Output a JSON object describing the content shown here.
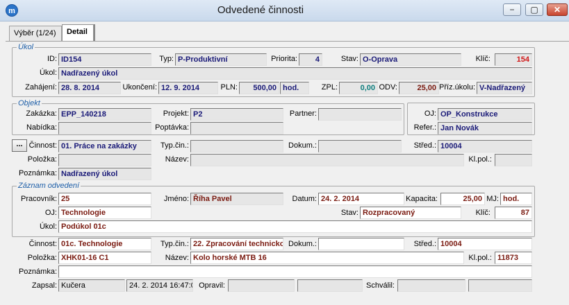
{
  "window": {
    "title": "Odvedené činnosti",
    "icon": "m",
    "controls": [
      "−",
      "▢",
      "✕"
    ]
  },
  "tabs": [
    {
      "label": "Výběr (1/24)"
    },
    {
      "label": "Detail"
    }
  ],
  "ukol": {
    "legend": "Úkol",
    "id_label": "ID:",
    "id": "ID154",
    "typ_label": "Typ:",
    "typ": "P-Produktivní",
    "priorita_label": "Priorita:",
    "priorita": "4",
    "stav_label": "Stav:",
    "stav": "O-Oprava",
    "klic_label": "Klíč:",
    "klic": "154",
    "ukol_label": "Úkol:",
    "ukol": "Nadřazený úkol",
    "zahajeni_label": "Zahájení:",
    "zahajeni": "28. 8. 2014",
    "ukonceni_label": "Ukončení:",
    "ukonceni": "12. 9. 2014",
    "pln_label": "PLN:",
    "pln": "500,00",
    "pln_unit": "hod.",
    "zpl_label": "ZPL:",
    "zpl": "0,00",
    "odv_label": "ODV:",
    "odv": "25,00",
    "priz_label": "Příz.úkolu:",
    "priz": "V-Nadřazený"
  },
  "objekt": {
    "legend": "Objekt",
    "zakazka_label": "Zakázka:",
    "zakazka": "EPP_140218",
    "projekt_label": "Projekt:",
    "projekt": "P2",
    "partner_label": "Partner:",
    "partner": "",
    "nabidka_label": "Nabídka:",
    "nabidka": "",
    "poptavka_label": "Poptávka:",
    "poptavka": "",
    "oj_label": "OJ:",
    "oj": "OP_Konstrukce",
    "refer_label": "Refer.:",
    "refer": "Jan Novák"
  },
  "cinnost1": {
    "dots": "...",
    "cinnost_label": "Činnost:",
    "cinnost": "01. Práce na zakázky",
    "typcin_label": "Typ.čin.:",
    "typcin": "",
    "dokum_label": "Dokum.:",
    "dokum": "",
    "stred_label": "Střed.:",
    "stred": "10004",
    "polozka_label": "Položka:",
    "polozka": "",
    "nazev_label": "Název:",
    "nazev": "",
    "klpol_label": "Kl.pol.:",
    "klpol": "",
    "poznamka_label": "Poznámka:",
    "poznamka": "Nadřazený úkol"
  },
  "zaznam": {
    "legend": "Záznam odvedení",
    "pracovnik_label": "Pracovník:",
    "pracovnik": "25",
    "jmeno_label": "Jméno:",
    "jmeno": "Říha Pavel",
    "datum_label": "Datum:",
    "datum": "24. 2. 2014",
    "kapacita_label": "Kapacita:",
    "kapacita": "25,00",
    "mj_label": "MJ:",
    "mj": "hod.",
    "oj_label": "OJ:",
    "oj": "Technologie",
    "stav_label": "Stav:",
    "stav": "Rozpracovaný",
    "klic_label": "Klíč:",
    "klic": "87",
    "ukol_label": "Úkol:",
    "ukol": "Podúkol 01c"
  },
  "cinnost2": {
    "cinnost_label": "Činnost:",
    "cinnost": "01c. Technologie",
    "typcin_label": "Typ.čin.:",
    "typcin": "22. Zpracování technicko",
    "dokum_label": "Dokum.:",
    "dokum": "",
    "stred_label": "Střed.:",
    "stred": "10004",
    "polozka_label": "Položka:",
    "polozka": "XHK01-16 C1",
    "nazev_label": "Název:",
    "nazev": "Kolo horské MTB 16",
    "klpol_label": "Kl.pol.:",
    "klpol": "11873",
    "poznamka_label": "Poznámka:",
    "poznamka": "",
    "zapsal_label": "Zapsal:",
    "zapsal": "Kučera",
    "zapsal_date": "24. 2. 2014 16:47:0",
    "opravil_label": "Opravil:",
    "opravil": "",
    "opravil_date": "",
    "schvalil_label": "Schválil:",
    "schvalil": "",
    "schvalil_date": ""
  }
}
